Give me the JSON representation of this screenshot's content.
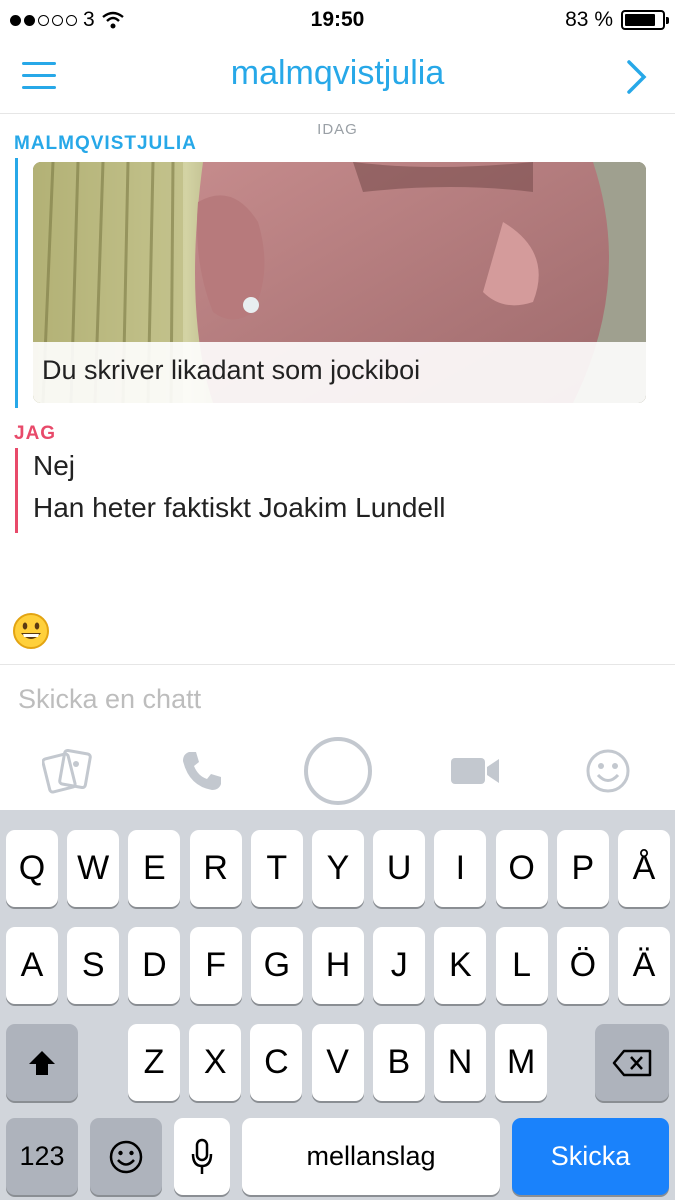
{
  "status_bar": {
    "carrier": "3",
    "time": "19:50",
    "battery_text": "83 %",
    "battery_level": 0.83,
    "signal_bars": 2
  },
  "header": {
    "title": "malmqvistjulia"
  },
  "conversation": {
    "date_label": "IDAG",
    "other_sender": "MALMQVISTJULIA",
    "snap_caption": "Du skriver likadant som jockiboi",
    "me_sender": "JAG",
    "messages": [
      "Nej",
      "Han heter faktiskt Joakim Lundell"
    ]
  },
  "input": {
    "placeholder": "Skicka en chatt"
  },
  "actions": [
    "memories-icon",
    "phone-icon",
    "capture-button",
    "video-icon",
    "smiley-icon"
  ],
  "keyboard": {
    "row1": [
      "Q",
      "W",
      "E",
      "R",
      "T",
      "Y",
      "U",
      "I",
      "O",
      "P",
      "Å"
    ],
    "row2": [
      "A",
      "S",
      "D",
      "F",
      "G",
      "H",
      "J",
      "K",
      "L",
      "Ö",
      "Ä"
    ],
    "row3": [
      "Z",
      "X",
      "C",
      "V",
      "B",
      "N",
      "M"
    ],
    "numbers_label": "123",
    "space_label": "mellanslag",
    "send_label": "Skicka"
  },
  "colors": {
    "accent": "#27a8e8",
    "me": "#e84a6a",
    "send": "#1a82fb"
  }
}
